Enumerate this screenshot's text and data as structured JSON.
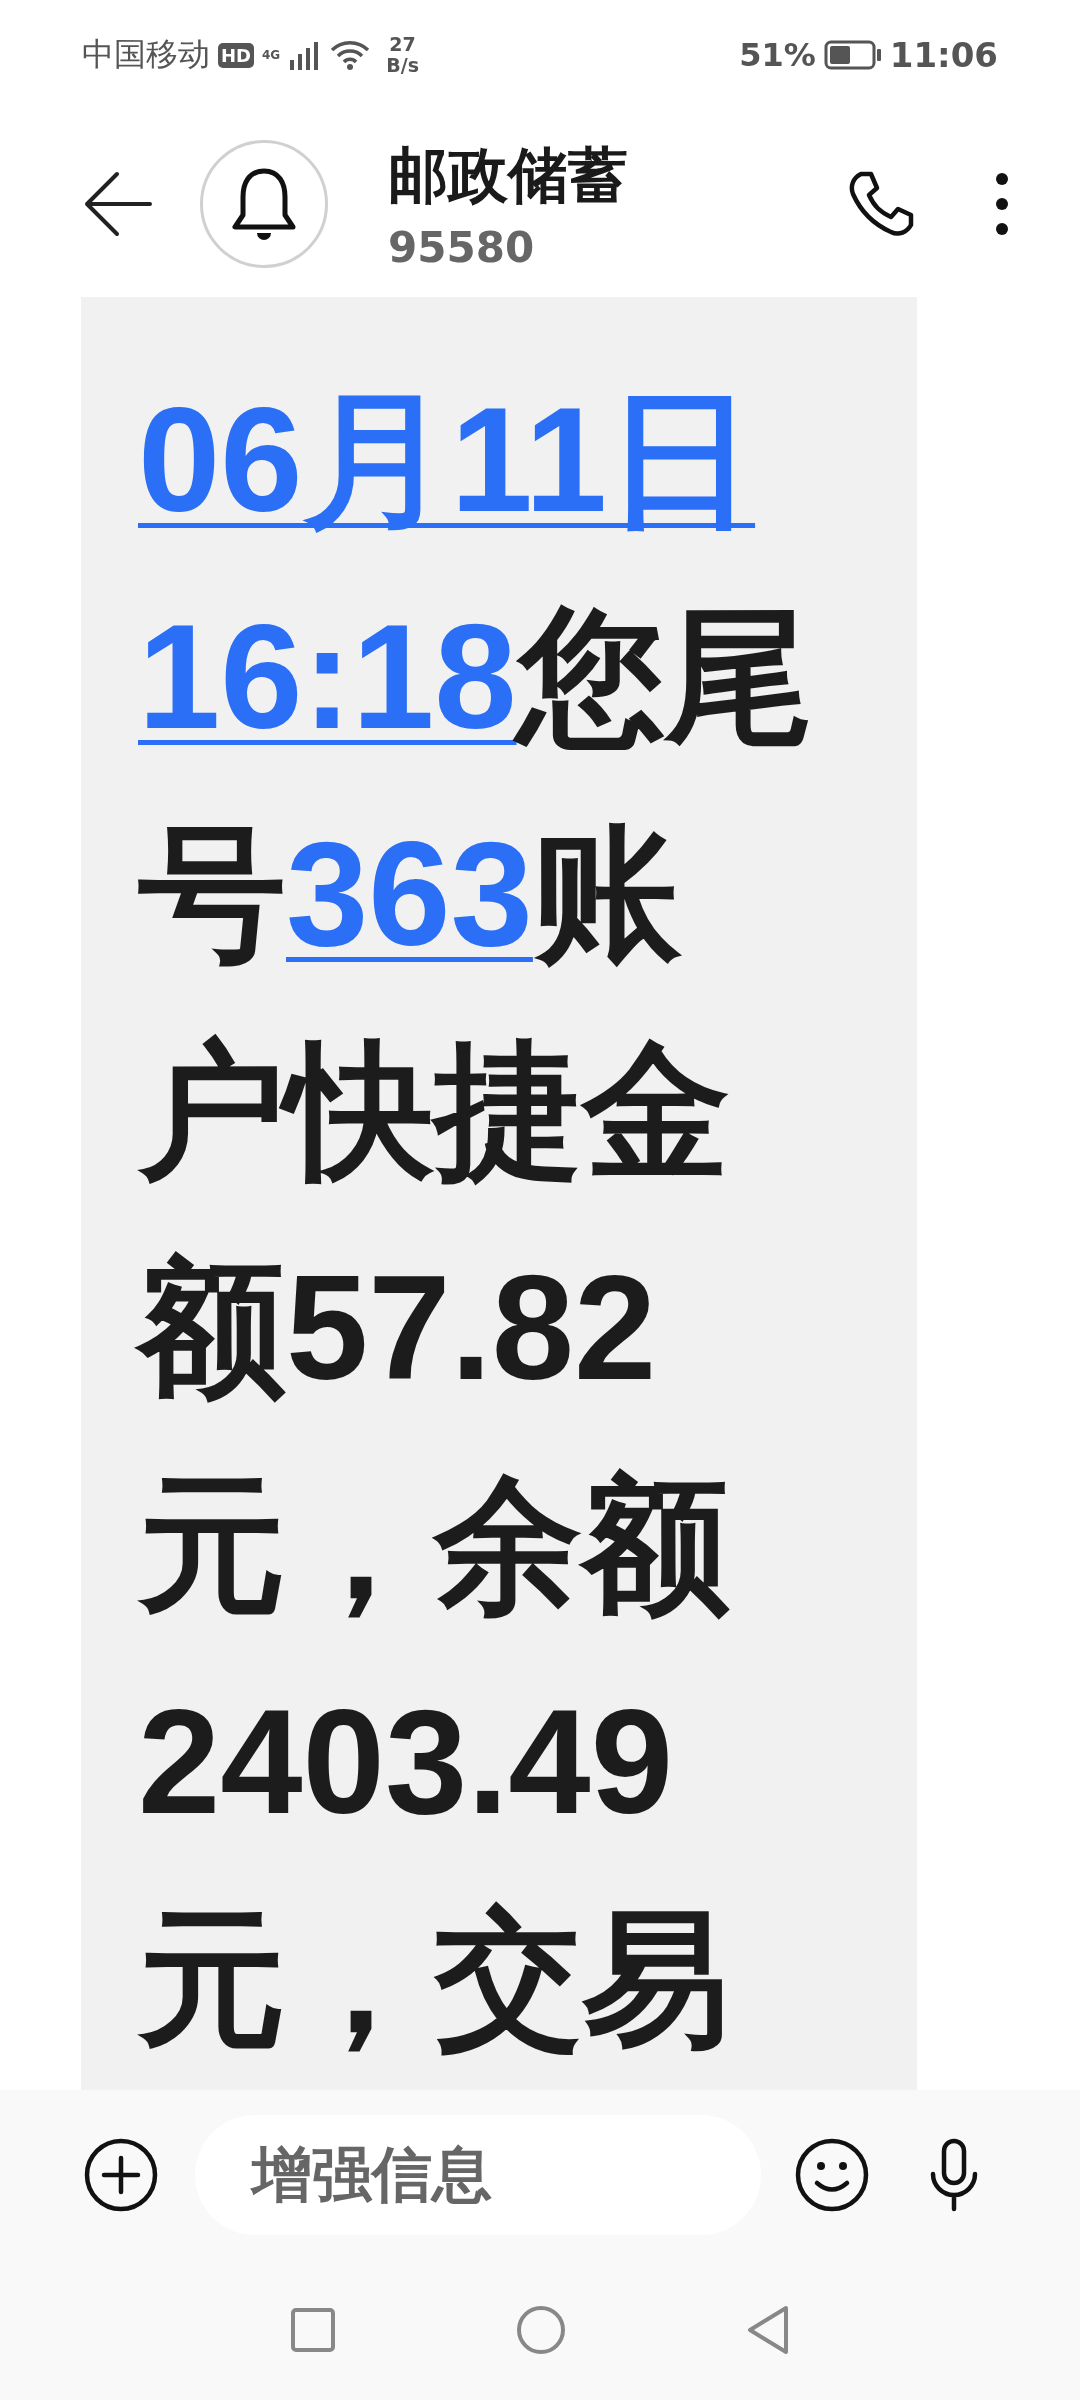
{
  "status_bar": {
    "carrier": "中国移动",
    "hd_badge": "HD",
    "network": "4G",
    "speed_value": "27",
    "speed_unit": "B/s",
    "battery_percent": "51%",
    "time": "11:06"
  },
  "header": {
    "title": "邮政储蓄",
    "subtitle": "95580"
  },
  "message": {
    "lines": [
      [
        {
          "text": "06月11日",
          "link": true
        }
      ],
      [
        {
          "text": "16:18",
          "link": true
        },
        {
          "text": "您尾",
          "link": false
        }
      ],
      [
        {
          "text": "号",
          "link": false
        },
        {
          "text": "363",
          "link": true
        },
        {
          "text": "账",
          "link": false
        }
      ],
      [
        {
          "text": "户快捷金",
          "link": false
        }
      ],
      [
        {
          "text": "额57.82",
          "link": false
        }
      ],
      [
        {
          "text": "元，余额",
          "link": false
        }
      ],
      [
        {
          "text": "2403.49",
          "link": false
        }
      ],
      [
        {
          "text": "元，交易",
          "link": false
        }
      ]
    ]
  },
  "composer": {
    "placeholder": "增强信息"
  }
}
